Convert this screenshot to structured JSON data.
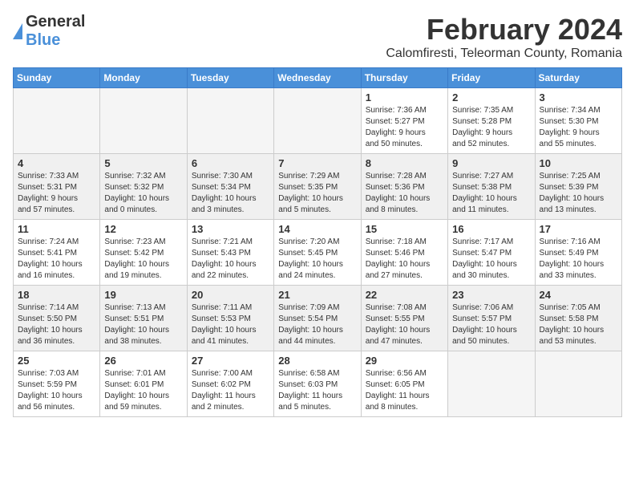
{
  "header": {
    "logo_general": "General",
    "logo_blue": "Blue",
    "month_year": "February 2024",
    "location": "Calomfiresti, Teleorman County, Romania"
  },
  "days_of_week": [
    "Sunday",
    "Monday",
    "Tuesday",
    "Wednesday",
    "Thursday",
    "Friday",
    "Saturday"
  ],
  "weeks": [
    [
      {
        "day": "",
        "info": ""
      },
      {
        "day": "",
        "info": ""
      },
      {
        "day": "",
        "info": ""
      },
      {
        "day": "",
        "info": ""
      },
      {
        "day": "1",
        "info": "Sunrise: 7:36 AM\nSunset: 5:27 PM\nDaylight: 9 hours\nand 50 minutes."
      },
      {
        "day": "2",
        "info": "Sunrise: 7:35 AM\nSunset: 5:28 PM\nDaylight: 9 hours\nand 52 minutes."
      },
      {
        "day": "3",
        "info": "Sunrise: 7:34 AM\nSunset: 5:30 PM\nDaylight: 9 hours\nand 55 minutes."
      }
    ],
    [
      {
        "day": "4",
        "info": "Sunrise: 7:33 AM\nSunset: 5:31 PM\nDaylight: 9 hours\nand 57 minutes."
      },
      {
        "day": "5",
        "info": "Sunrise: 7:32 AM\nSunset: 5:32 PM\nDaylight: 10 hours\nand 0 minutes."
      },
      {
        "day": "6",
        "info": "Sunrise: 7:30 AM\nSunset: 5:34 PM\nDaylight: 10 hours\nand 3 minutes."
      },
      {
        "day": "7",
        "info": "Sunrise: 7:29 AM\nSunset: 5:35 PM\nDaylight: 10 hours\nand 5 minutes."
      },
      {
        "day": "8",
        "info": "Sunrise: 7:28 AM\nSunset: 5:36 PM\nDaylight: 10 hours\nand 8 minutes."
      },
      {
        "day": "9",
        "info": "Sunrise: 7:27 AM\nSunset: 5:38 PM\nDaylight: 10 hours\nand 11 minutes."
      },
      {
        "day": "10",
        "info": "Sunrise: 7:25 AM\nSunset: 5:39 PM\nDaylight: 10 hours\nand 13 minutes."
      }
    ],
    [
      {
        "day": "11",
        "info": "Sunrise: 7:24 AM\nSunset: 5:41 PM\nDaylight: 10 hours\nand 16 minutes."
      },
      {
        "day": "12",
        "info": "Sunrise: 7:23 AM\nSunset: 5:42 PM\nDaylight: 10 hours\nand 19 minutes."
      },
      {
        "day": "13",
        "info": "Sunrise: 7:21 AM\nSunset: 5:43 PM\nDaylight: 10 hours\nand 22 minutes."
      },
      {
        "day": "14",
        "info": "Sunrise: 7:20 AM\nSunset: 5:45 PM\nDaylight: 10 hours\nand 24 minutes."
      },
      {
        "day": "15",
        "info": "Sunrise: 7:18 AM\nSunset: 5:46 PM\nDaylight: 10 hours\nand 27 minutes."
      },
      {
        "day": "16",
        "info": "Sunrise: 7:17 AM\nSunset: 5:47 PM\nDaylight: 10 hours\nand 30 minutes."
      },
      {
        "day": "17",
        "info": "Sunrise: 7:16 AM\nSunset: 5:49 PM\nDaylight: 10 hours\nand 33 minutes."
      }
    ],
    [
      {
        "day": "18",
        "info": "Sunrise: 7:14 AM\nSunset: 5:50 PM\nDaylight: 10 hours\nand 36 minutes."
      },
      {
        "day": "19",
        "info": "Sunrise: 7:13 AM\nSunset: 5:51 PM\nDaylight: 10 hours\nand 38 minutes."
      },
      {
        "day": "20",
        "info": "Sunrise: 7:11 AM\nSunset: 5:53 PM\nDaylight: 10 hours\nand 41 minutes."
      },
      {
        "day": "21",
        "info": "Sunrise: 7:09 AM\nSunset: 5:54 PM\nDaylight: 10 hours\nand 44 minutes."
      },
      {
        "day": "22",
        "info": "Sunrise: 7:08 AM\nSunset: 5:55 PM\nDaylight: 10 hours\nand 47 minutes."
      },
      {
        "day": "23",
        "info": "Sunrise: 7:06 AM\nSunset: 5:57 PM\nDaylight: 10 hours\nand 50 minutes."
      },
      {
        "day": "24",
        "info": "Sunrise: 7:05 AM\nSunset: 5:58 PM\nDaylight: 10 hours\nand 53 minutes."
      }
    ],
    [
      {
        "day": "25",
        "info": "Sunrise: 7:03 AM\nSunset: 5:59 PM\nDaylight: 10 hours\nand 56 minutes."
      },
      {
        "day": "26",
        "info": "Sunrise: 7:01 AM\nSunset: 6:01 PM\nDaylight: 10 hours\nand 59 minutes."
      },
      {
        "day": "27",
        "info": "Sunrise: 7:00 AM\nSunset: 6:02 PM\nDaylight: 11 hours\nand 2 minutes."
      },
      {
        "day": "28",
        "info": "Sunrise: 6:58 AM\nSunset: 6:03 PM\nDaylight: 11 hours\nand 5 minutes."
      },
      {
        "day": "29",
        "info": "Sunrise: 6:56 AM\nSunset: 6:05 PM\nDaylight: 11 hours\nand 8 minutes."
      },
      {
        "day": "",
        "info": ""
      },
      {
        "day": "",
        "info": ""
      }
    ]
  ]
}
